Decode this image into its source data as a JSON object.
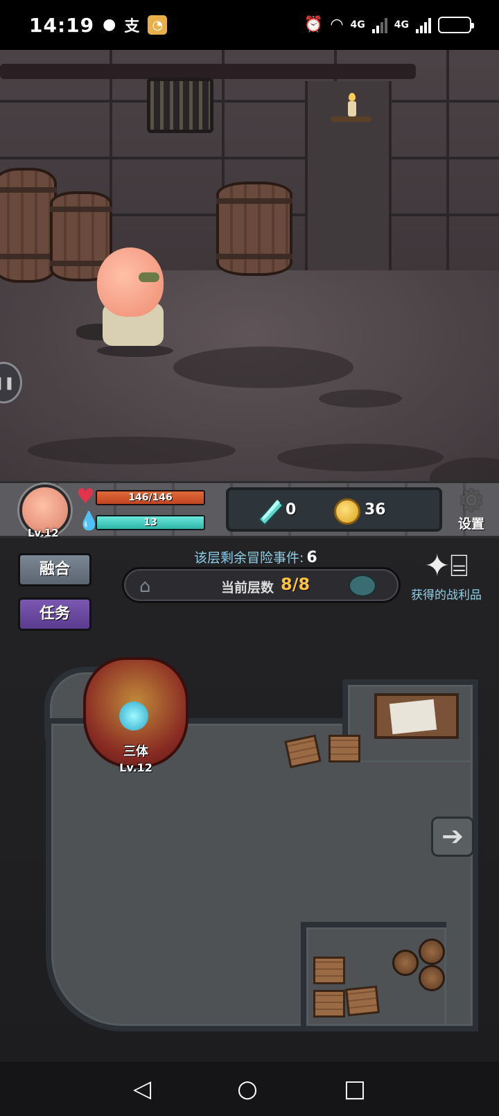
{
  "status_bar": {
    "time": "14:19",
    "icons": [
      "wechat-icon",
      "alipay-icon",
      "app-notification-icon",
      "alarm-icon",
      "wifi-icon",
      "signal-4g-icon",
      "signal-4g-icon",
      "battery-low-icon"
    ],
    "alipay_glyph": "支",
    "net1": "4G",
    "net2": "4G",
    "battery_level": 0.2
  },
  "hud": {
    "player_level": "Lv.12",
    "hp_text": "146/146",
    "hp_fraction": 1.0,
    "mp_text": "13",
    "mp_fraction": 1.0,
    "crystal_value": "0",
    "coin_value": "36",
    "settings_label": "设置"
  },
  "panel": {
    "merge_label": "融合",
    "quest_label": "任务",
    "events_label": "该层剩余冒险事件:",
    "events_value": "6",
    "floor_label": "当前层数",
    "floor_value": "8/8",
    "loot_label": "获得的战利品"
  },
  "enemy": {
    "name": "三体",
    "level": "Lv.12"
  },
  "colors": {
    "hp": "#c24522",
    "mp": "#2fb4a8",
    "floor_value": "#ffc23a",
    "accent_text": "#8fd0e8",
    "quest_button": "#5a3b8e"
  }
}
